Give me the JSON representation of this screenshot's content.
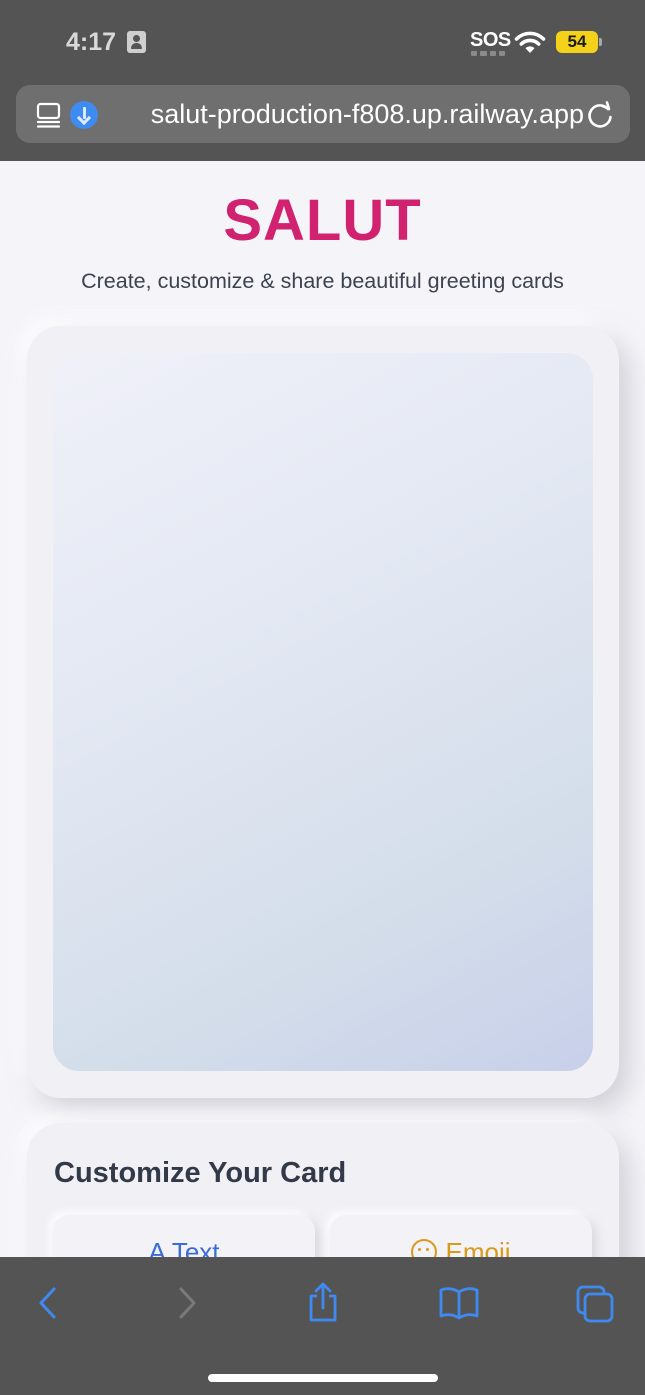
{
  "status_bar": {
    "time": "4:17",
    "sos": "SOS",
    "battery": "54"
  },
  "browser": {
    "url": "salut-production-f808.up.railway.app"
  },
  "page": {
    "brand_title": "SALUT",
    "tagline": "Create, customize & share beautiful greeting cards",
    "customize": {
      "title": "Customize Your Card",
      "options": [
        {
          "label": "Text",
          "icon": "text-icon"
        },
        {
          "label": "Emoji",
          "icon": "emoji-icon"
        }
      ]
    }
  },
  "toolbar": {
    "items": [
      "back-icon",
      "forward-icon",
      "share-icon",
      "bookmarks-icon",
      "tabs-icon"
    ]
  },
  "colors": {
    "brand": "#d1226f",
    "accent": "#3e8bf2",
    "chrome": "#545454"
  }
}
